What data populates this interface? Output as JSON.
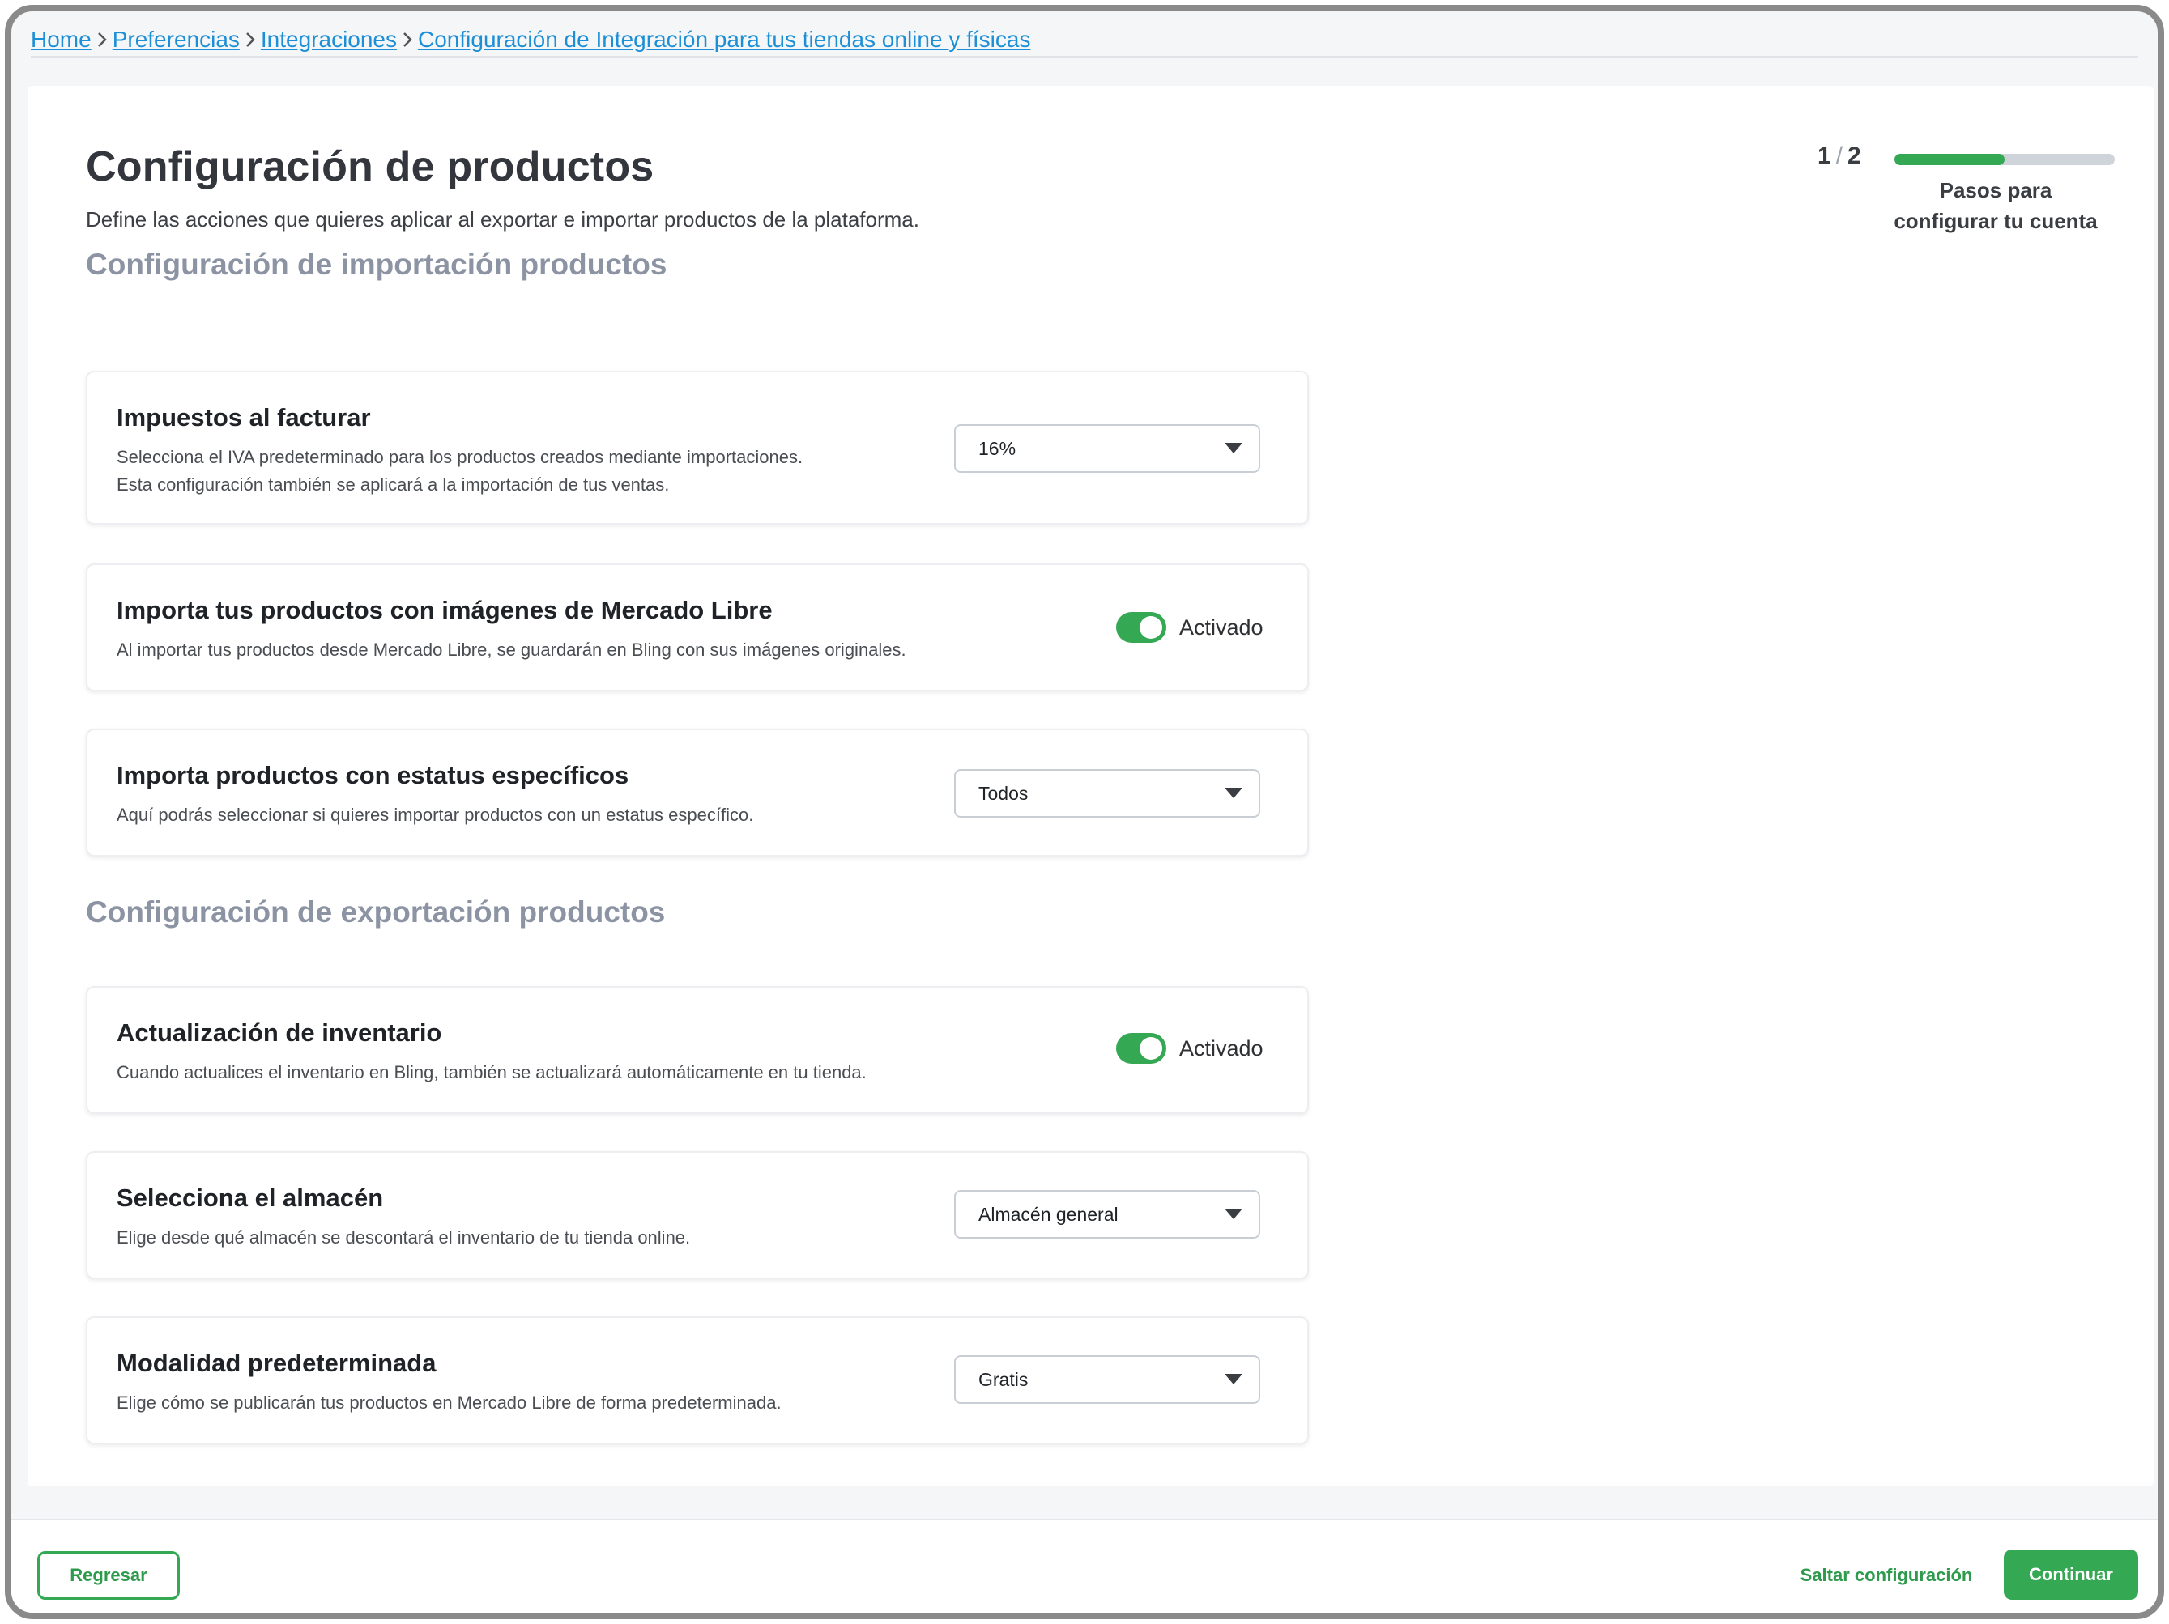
{
  "breadcrumb": {
    "items": [
      "Home",
      "Preferencias",
      "Integraciones",
      "Configuración de Integración para tus tiendas online y físicas"
    ]
  },
  "page": {
    "title": "Configuración de productos",
    "subtitle": "Define las acciones que quieres aplicar al exportar e importar productos de la plataforma."
  },
  "progress": {
    "current": "1",
    "total": "2",
    "separator": "/",
    "fraction": 0.5,
    "label_line1": "Pasos para",
    "label_line2": "configurar tu cuenta"
  },
  "import_section": {
    "title": "Configuración de importación productos",
    "taxes": {
      "title": "Impuestos al facturar",
      "desc_line1": "Selecciona el IVA predeterminado para los productos creados mediante importaciones.",
      "desc_line2": "Esta configuración también se aplicará a la importación de tus ventas.",
      "value": "16%"
    },
    "images": {
      "title": "Importa tus productos con imágenes de Mercado Libre",
      "desc": "Al importar tus productos desde Mercado Libre, se guardarán en Bling con sus imágenes originales.",
      "toggle_label": "Activado"
    },
    "status": {
      "title": "Importa productos con estatus específicos",
      "desc": "Aquí podrás seleccionar si quieres importar productos con un estatus específico.",
      "value": "Todos"
    }
  },
  "export_section": {
    "title": "Configuración de exportación productos",
    "inventory": {
      "title": "Actualización de inventario",
      "desc": "Cuando actualices el inventario en Bling, también se actualizará automáticamente en tu tienda.",
      "toggle_label": "Activado"
    },
    "warehouse": {
      "title": "Selecciona el almacén",
      "desc": "Elige desde qué almacén se descontará el inventario de tu tienda online.",
      "value": "Almacén general"
    },
    "modality": {
      "title": "Modalidad predeterminada",
      "desc": "Elige cómo se publicarán tus productos en Mercado Libre de forma predeterminada.",
      "value": "Gratis"
    }
  },
  "footer": {
    "back_label": "Regresar",
    "skip_label": "Saltar configuración",
    "continue_label": "Continuar"
  },
  "colors": {
    "accent": "#34a853",
    "link": "#1d8fd6",
    "section_title": "#8c94a4"
  }
}
